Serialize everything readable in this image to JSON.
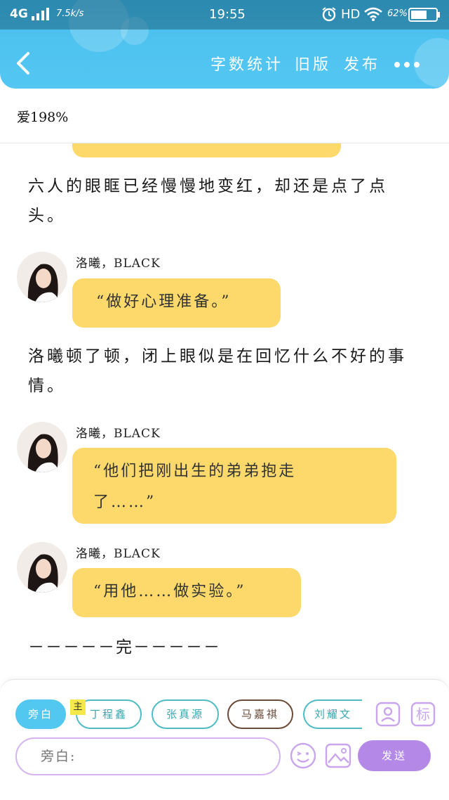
{
  "status_bar": {
    "network": "4G",
    "speed": "7.5k/s",
    "time": "19:55",
    "hd": "HD",
    "battery": "62%"
  },
  "header": {
    "actions": [
      {
        "label": "字数统计",
        "icon": "word-count"
      },
      {
        "label": "旧版",
        "icon": "old-version"
      },
      {
        "label": "发布",
        "icon": "publish"
      }
    ],
    "more_icon": "more-horizontal-icon",
    "back_icon": "chevron-left-icon"
  },
  "progress": {
    "text": "爱198%"
  },
  "story": {
    "narration_1": "六人的眼眶已经慢慢地变红，却还是点了点头。",
    "block_1": {
      "speaker": "洛曦，BLACK",
      "message": "“做好心理准备。”"
    },
    "narration_2": "洛曦顿了顿，闭上眼似是在回忆什么不好的事情。",
    "block_2": {
      "speaker": "洛曦，BLACK",
      "message_line_1": "“他们把刚出生的弟弟抱走",
      "message_line_2": "了……”"
    },
    "block_3": {
      "speaker": "洛曦，BLACK",
      "message": "“用他……做实验。”"
    },
    "ending": "－－－－－完－－－－－"
  },
  "input_panel": {
    "role_chips": [
      {
        "label": "旁白",
        "selected": true
      },
      {
        "label": "丁程鑫",
        "badge": "主"
      },
      {
        "label": "张真源"
      },
      {
        "label": "马嘉祺"
      },
      {
        "label": "刘耀文"
      }
    ],
    "tool_icons": [
      "character-icon",
      "tag-icon"
    ],
    "tag_label": "标",
    "input_placeholder": "旁白:",
    "send_label": "发送",
    "emoji_icon": "emoji-icon",
    "image_icon": "image-icon"
  },
  "colors": {
    "header_blue": "#4fc3f0",
    "bubble_yellow": "#fcd96a",
    "accent_purple": "#b388e6",
    "chip_teal": "#4fbcc4",
    "chip_brown": "#6b4a3a"
  }
}
